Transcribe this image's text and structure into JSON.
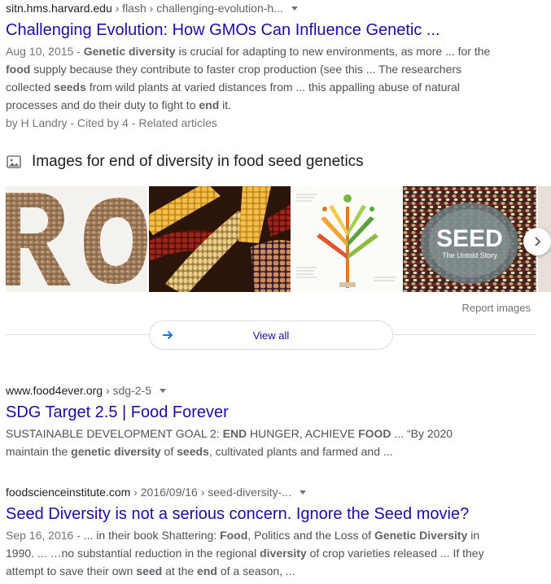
{
  "results": [
    {
      "site": "sitn.hms.harvard.edu",
      "path": " › flash › challenging-evolution-h...",
      "title": "Challenging Evolution: How GMOs Can Influence Genetic ...",
      "date": "Aug 10, 2015 - ",
      "snippet_parts": [
        {
          "t": "Genetic diversity",
          "b": true
        },
        {
          "t": " is crucial for adapting to new environments, as more ... for the ",
          "b": false
        },
        {
          "t": "food",
          "b": true
        },
        {
          "t": " supply because they contribute to faster crop production (see this ... The researchers collected ",
          "b": false
        },
        {
          "t": "seeds",
          "b": true
        },
        {
          "t": " from wild plants at varied distances from ... this appalling abuse of natural processes and do their duty to fight to ",
          "b": false
        },
        {
          "t": "end",
          "b": true
        },
        {
          "t": " it.",
          "b": false
        }
      ],
      "meta": "by H Landry - Cited by 4 - Related articles"
    },
    {
      "site": "www.food4ever.org",
      "path": " › sdg-2-5",
      "title": "SDG Target 2.5 | Food Forever",
      "date": "",
      "snippet_parts": [
        {
          "t": "SUSTAINABLE DEVELOPMENT GOAL 2: ",
          "b": false
        },
        {
          "t": "END",
          "b": true
        },
        {
          "t": " HUNGER, ACHIEVE ",
          "b": false
        },
        {
          "t": "FOOD",
          "b": true
        },
        {
          "t": " ... “By 2020 maintain the ",
          "b": false
        },
        {
          "t": "genetic diversity",
          "b": true
        },
        {
          "t": " of ",
          "b": false
        },
        {
          "t": "seeds",
          "b": true
        },
        {
          "t": ", cultivated plants and farmed and ...",
          "b": false
        }
      ],
      "meta": ""
    },
    {
      "site": "foodscienceinstitute.com",
      "path": " › 2016/09/16 › seed-diversity-...",
      "title": "Seed Diversity is not a serious concern. Ignore the Seed movie?",
      "date": "Sep 16, 2016 - ",
      "snippet_parts": [
        {
          "t": "... in their book Shattering: ",
          "b": false
        },
        {
          "t": "Food",
          "b": true
        },
        {
          "t": ", Politics and the Loss of ",
          "b": false
        },
        {
          "t": "Genetic Diversity",
          "b": true
        },
        {
          "t": " in 1990. ... …no substantial reduction in the regional ",
          "b": false
        },
        {
          "t": "diversity",
          "b": true
        },
        {
          "t": " of crop varieties released ... If they attempt to save their own ",
          "b": false
        },
        {
          "t": "seed",
          "b": true
        },
        {
          "t": " at the ",
          "b": false
        },
        {
          "t": "end",
          "b": true
        },
        {
          "t": " of a season, ...",
          "b": false
        }
      ],
      "meta": ""
    }
  ],
  "images_section": {
    "heading": "Images for end of diversity in food seed genetics",
    "thumbnails": [
      "seeds-letters-image",
      "corn-varieties-image",
      "plant-infographic-image",
      "seed-documentary-poster-image"
    ],
    "poster_title": "SEED",
    "poster_subtitle": "The Untold Story",
    "report_label": "Report images",
    "view_all_label": "View all"
  },
  "colors": {
    "link": "#1a0dab",
    "text": "#4d5156",
    "muted": "#70757a",
    "border": "#dadce0"
  }
}
